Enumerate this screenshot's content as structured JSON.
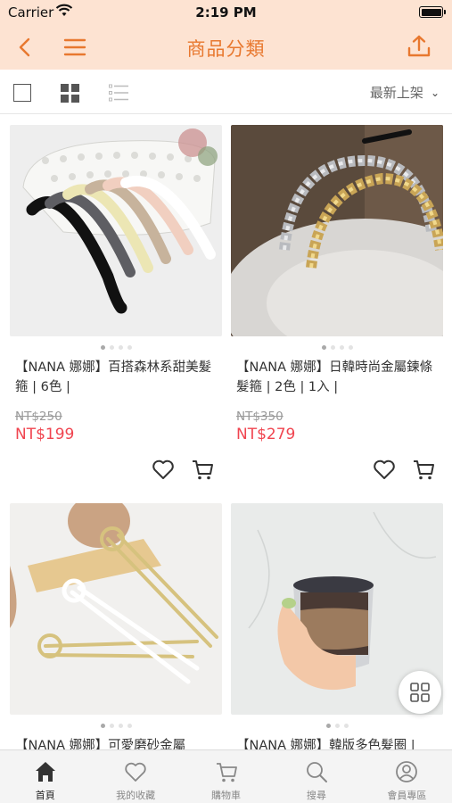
{
  "status_bar": {
    "carrier": "Carrier",
    "time": "2:19 PM"
  },
  "header": {
    "title": "商品分類"
  },
  "toolbar": {
    "sort_label": "最新上架"
  },
  "products": [
    {
      "name": "【NANA 娜娜】百搭森林系甜美髮箍 | 6色 |",
      "original_price": "NT$250",
      "price": "NT$199"
    },
    {
      "name": "【NANA 娜娜】日韓時尚金屬鍊條髮箍 | 2色 | 1入 |",
      "original_price": "NT$350",
      "price": "NT$279"
    },
    {
      "name": "【NANA 娜娜】可愛磨砂金屬",
      "original_price": "",
      "price": ""
    },
    {
      "name": "【NANA 娜娜】韓版多色髮圈 |",
      "original_price": "",
      "price": ""
    }
  ],
  "tab_bar": {
    "items": [
      {
        "label": "首頁",
        "icon": "home-icon",
        "active": true
      },
      {
        "label": "我的收藏",
        "icon": "heart-icon"
      },
      {
        "label": "購物車",
        "icon": "cart-icon"
      },
      {
        "label": "搜尋",
        "icon": "search-icon"
      },
      {
        "label": "會員專區",
        "icon": "user-icon"
      }
    ]
  },
  "colors": {
    "header_bg": "#fde3d2",
    "accent": "#e8782f",
    "price": "#f0444f"
  }
}
